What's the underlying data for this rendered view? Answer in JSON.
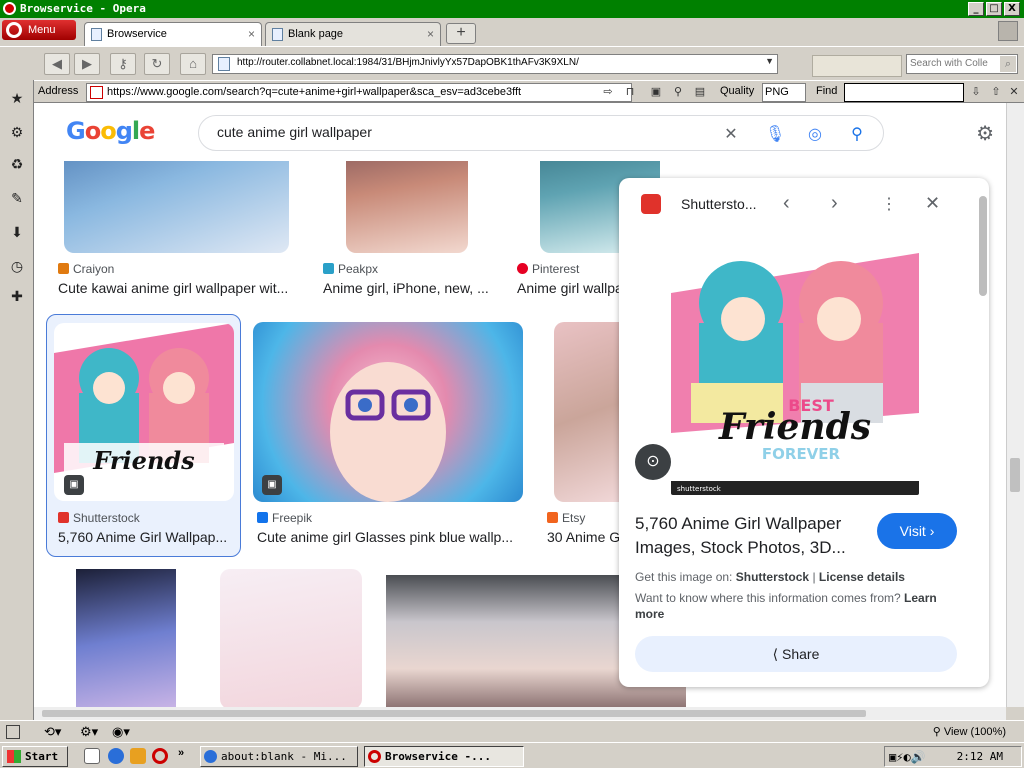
{
  "window": {
    "title": "Browservice - Opera",
    "btn_min": "_",
    "btn_max": "□",
    "btn_close": "X"
  },
  "tabs": {
    "menu_label": "Menu",
    "items": [
      {
        "label": "Browservice"
      },
      {
        "label": "Blank page"
      }
    ],
    "close": "×",
    "new_tab": "+"
  },
  "nav": {
    "url": "http://router.collabnet.local:1984/31/BHjmJnivlyYx57DapOBK1thAFv3K9XLN/",
    "search_placeholder": "Search with Colle"
  },
  "addr": {
    "label": "Address",
    "value": "https://www.google.com/search?q=cute+anime+girl+wallpaper&sca_esv=ad3cebe3fft",
    "quality_label": "Quality",
    "quality_value": "PNG",
    "find_label": "Find"
  },
  "google": {
    "logo": "Google",
    "query": "cute anime girl wallpaper"
  },
  "results": [
    {
      "source": "Craiyon",
      "title": "Cute kawai anime girl wallpaper wit...",
      "color": "#e07a10"
    },
    {
      "source": "Peakpx",
      "title": "Anime girl, iPhone, new, ...",
      "color": "#2aa0c8"
    },
    {
      "source": "Pinterest",
      "title": "Anime girl wallpa",
      "color": "#e60023"
    },
    {
      "source": "Shutterstock",
      "title": "5,760 Anime Girl Wallpap...",
      "color": "#e0322b",
      "image_text": "Best Friends Forever"
    },
    {
      "source": "Freepik",
      "title": "Cute anime girl Glasses pink blue wallp...",
      "color": "#1273eb"
    },
    {
      "source": "Etsy",
      "title": "30 Anime G",
      "color": "#f1641e"
    }
  ],
  "side_panel": {
    "source": "Shutterstо...",
    "image_text_top": "BEST",
    "image_text_main": "Friends",
    "image_text_bottom": "FOREVER",
    "watermark": "shutterstock",
    "title": "5,760 Anime Girl Wallpaper Images, Stock Photos, 3D...",
    "visit": "Visit ›",
    "get_on": "Get this image on:",
    "get_on_source": "Shutterstock",
    "sep": "|",
    "license": "License details",
    "want": "Want to know where this information comes from?",
    "learn": "Learn more",
    "share": "Share"
  },
  "status": {
    "zoom": "View (100%)"
  },
  "taskbar": {
    "start": "Start",
    "tasks": [
      {
        "label": "about:blank - Mi..."
      },
      {
        "label": "Browservice -..."
      }
    ],
    "clock": "2:12 AM",
    "more": "»"
  }
}
